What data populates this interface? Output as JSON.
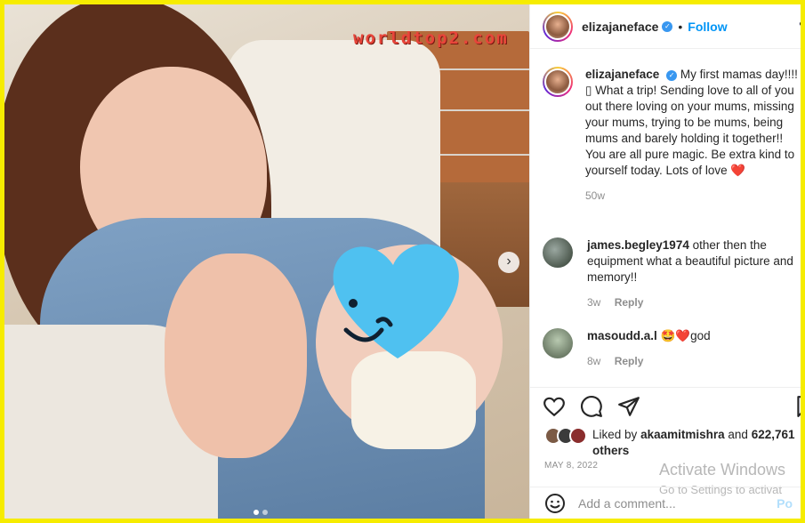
{
  "watermark": "worldtop2.com",
  "header": {
    "username": "elizajaneface",
    "dot": "•",
    "follow_label": "Follow",
    "more": "•"
  },
  "caption": {
    "username": "elizajaneface",
    "text": "My first mamas day!!!! ▯ What a trip! Sending love to all of you out there loving on your mums, missing your mums, trying to be mums, being mums and barely holding it together!! You are all pure magic. Be extra kind to yourself today. Lots of love",
    "emoji": "❤️",
    "age": "50w"
  },
  "comments": [
    {
      "username": "james.begley1974",
      "text": "other then the equipment what a beautiful picture and memory!!",
      "age": "3w",
      "reply": "Reply"
    },
    {
      "username": "masoudd.a.l",
      "text": "🤩❤️god",
      "age": "8w",
      "reply": "Reply"
    }
  ],
  "likes": {
    "prefix": "Liked by",
    "user": "akaamitmishra",
    "middle": "and",
    "count": "622,761",
    "suffix": "others"
  },
  "date": "MAY 8, 2022",
  "activate": {
    "line1": "Activate Windows",
    "line2": "Go to Settings to activat"
  },
  "add_comment": {
    "placeholder": "Add a comment...",
    "post_label": "Po"
  },
  "icons": [
    "verified-icon",
    "heart-icon",
    "comment-icon",
    "share-icon",
    "bookmark-icon",
    "emoji-icon",
    "chevron-right-icon"
  ],
  "colors": {
    "accent": "#0095f6",
    "border": "#f6ec00",
    "text": "#262626",
    "muted": "#8e8e8e"
  }
}
